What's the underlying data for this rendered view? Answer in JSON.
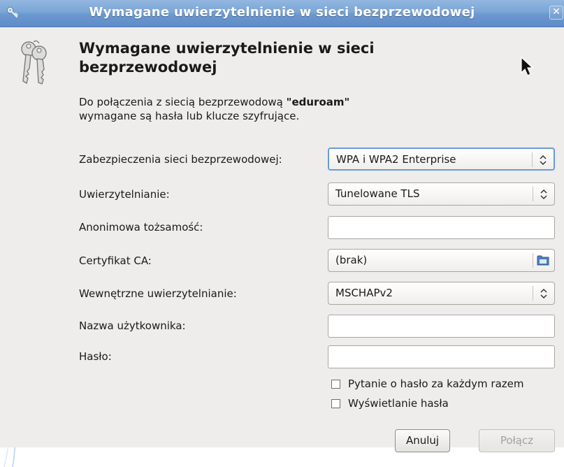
{
  "window": {
    "title": "Wymagane uwierzytelnienie w sieci bezprzewodowej",
    "close_glyph": "✕"
  },
  "dialog": {
    "heading": "Wymagane uwierzytelnienie w sieci bezprzewodowej",
    "desc_prefix": "Do połączenia z siecią bezprzewodową ",
    "network": "\"eduroam\"",
    "desc_line2": "wymagane są hasła lub klucze szyfrujące."
  },
  "form": {
    "security_label": "Zabezpieczenia sieci bezprzewodowej:",
    "security_value": "WPA i WPA2 Enterprise",
    "auth_label": "Uwierzytelnianie:",
    "auth_value": "Tunelowane TLS",
    "anon_label": "Anonimowa tożsamość:",
    "anon_value": "",
    "ca_label": "Certyfikat CA:",
    "ca_value": "(brak)",
    "inner_label": "Wewnętrzne uwierzytelnianie:",
    "inner_value": "MSCHAPv2",
    "user_label": "Nazwa użytkownika:",
    "user_value": "",
    "password_label": "Hasło:",
    "password_value": "",
    "ask_always_label": "Pytanie o hasło za każdym razem",
    "ask_always_checked": false,
    "show_password_label": "Wyświetlanie hasła",
    "show_password_checked": false
  },
  "buttons": {
    "cancel": "Anuluj",
    "connect": "Połącz"
  },
  "icons": {
    "titlebar": "key-icon",
    "dialog": "keys-icon",
    "combo": "up-down-arrows-icon",
    "file_chooser": "folder-icon",
    "pointer": "mouse-cursor-icon"
  },
  "colors": {
    "titlebar": "#7aa5d6",
    "window_bg": "#eeedeb",
    "focus_border": "#6a9bd6"
  }
}
